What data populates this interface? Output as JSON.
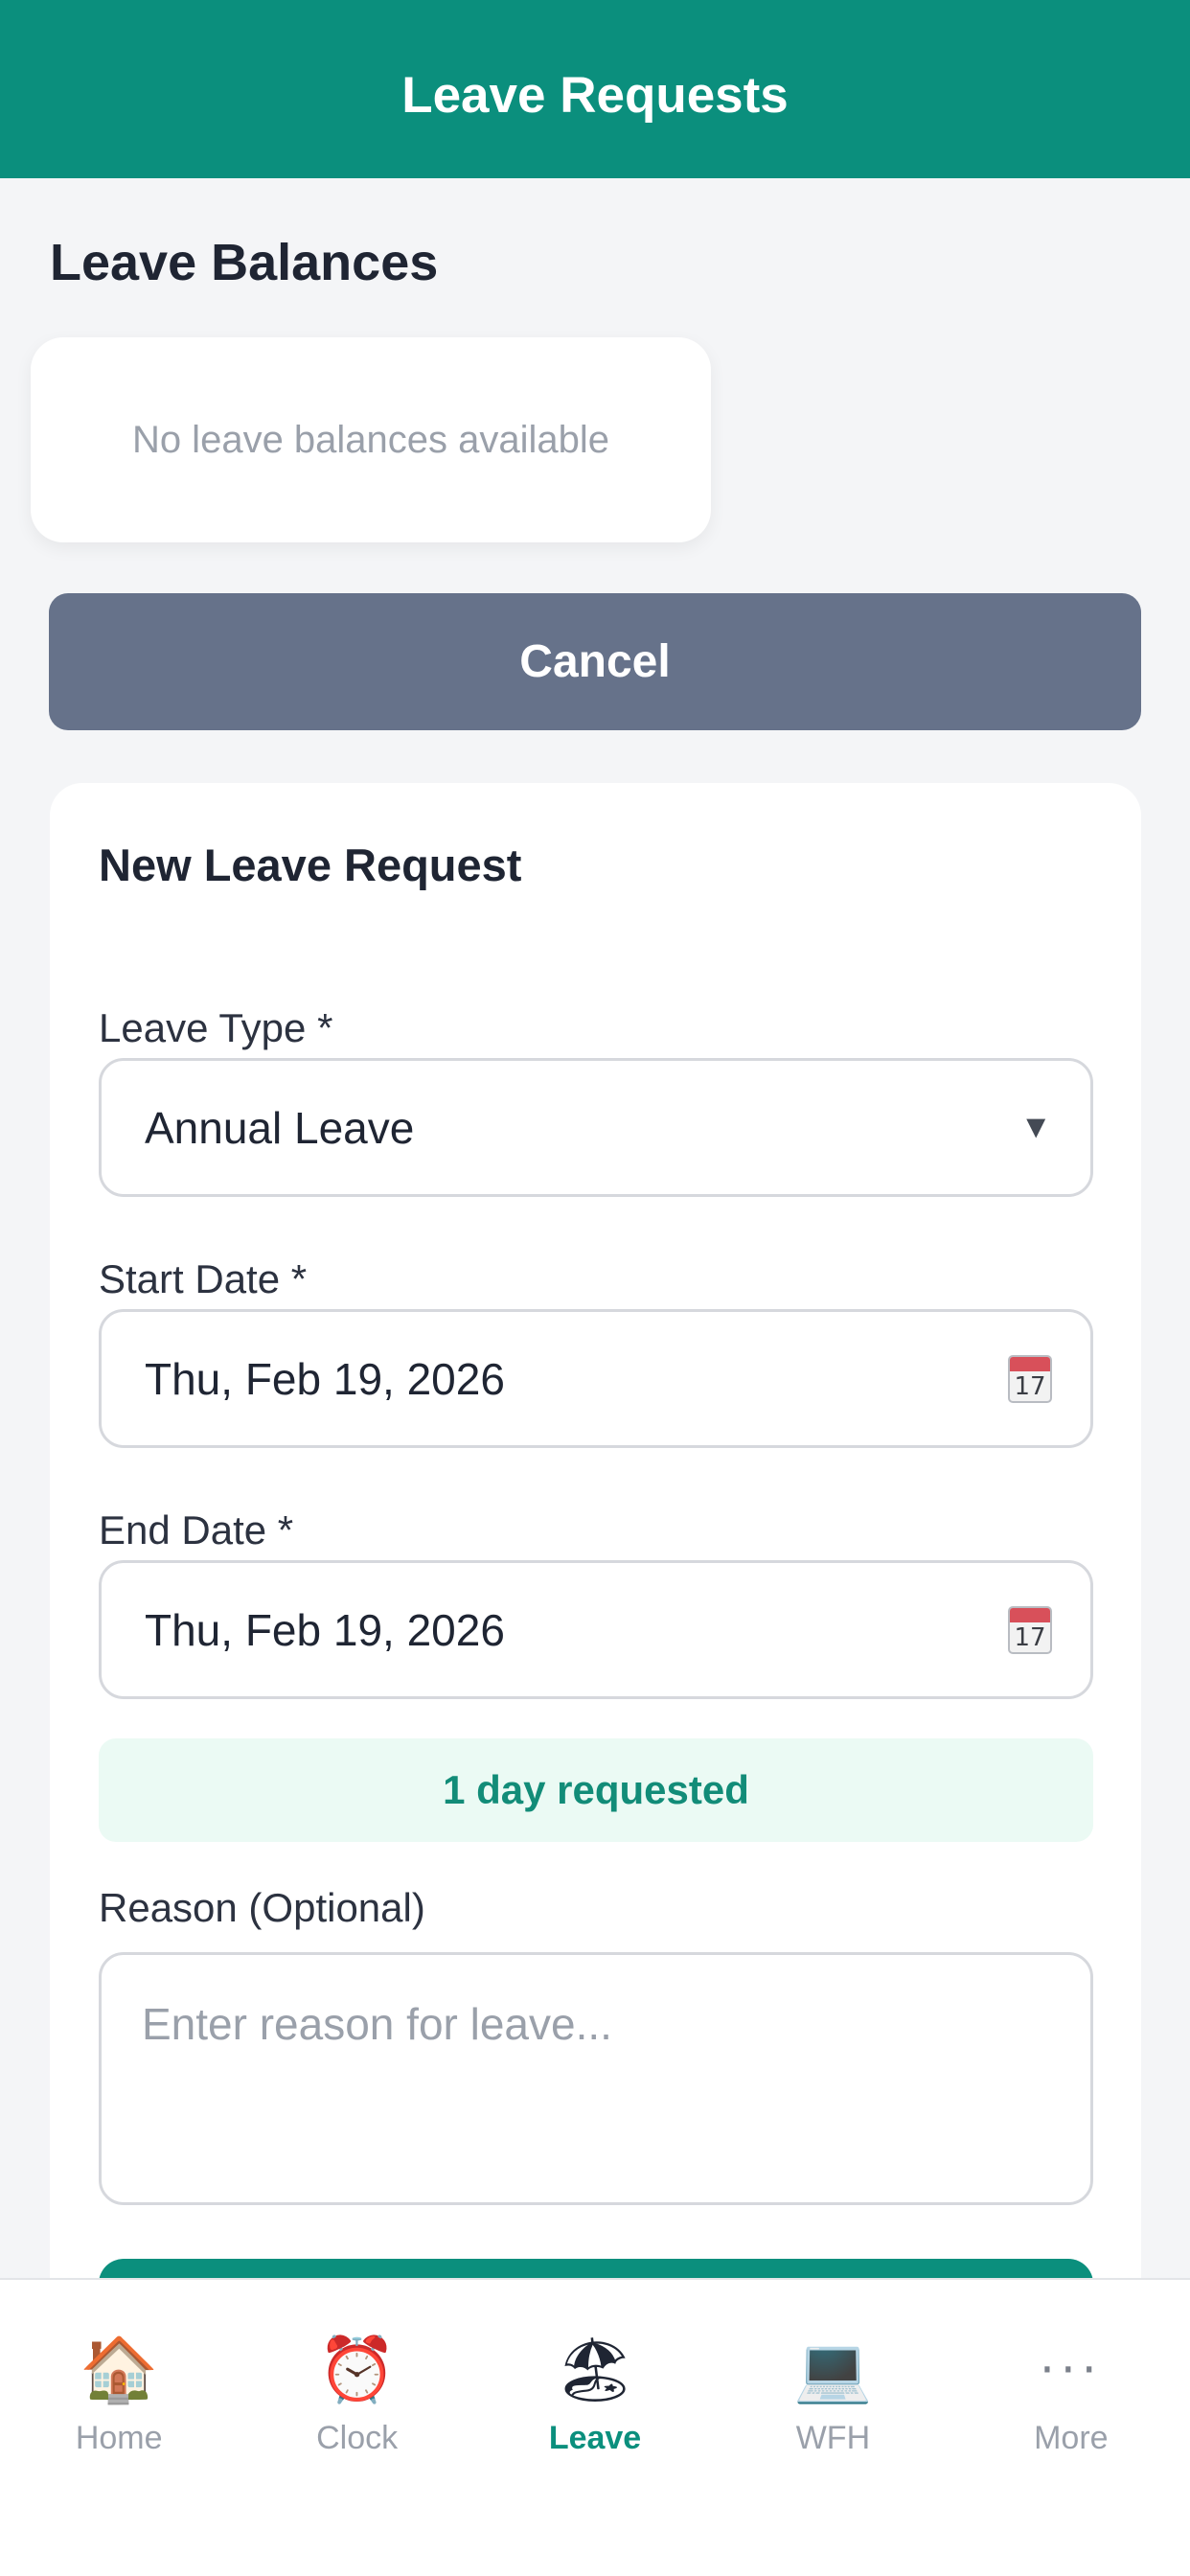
{
  "header": {
    "title": "Leave Requests"
  },
  "balances": {
    "title": "Leave Balances",
    "empty_text": "No leave balances available"
  },
  "cancel_button": {
    "label": "Cancel"
  },
  "form": {
    "title": "New Leave Request",
    "leave_type": {
      "label": "Leave Type *",
      "value": "Annual Leave"
    },
    "start_date": {
      "label": "Start Date *",
      "value": "Thu, Feb 19, 2026",
      "calendar_day": "17"
    },
    "end_date": {
      "label": "End Date *",
      "value": "Thu, Feb 19, 2026",
      "calendar_day": "17"
    },
    "days_requested": "1 day requested",
    "reason": {
      "label": "Reason (Optional)",
      "placeholder": "Enter reason for leave..."
    }
  },
  "tabbar": {
    "tabs": [
      {
        "label": "Home",
        "icon": "house-icon",
        "glyph": "🏠"
      },
      {
        "label": "Clock",
        "icon": "alarm-clock-icon",
        "glyph": "⏰"
      },
      {
        "label": "Leave",
        "icon": "beach-umbrella-icon",
        "glyph": "🏖"
      },
      {
        "label": "WFH",
        "icon": "laptop-icon",
        "glyph": "💻"
      },
      {
        "label": "More",
        "icon": "more-dots-icon",
        "glyph": "···"
      }
    ],
    "active": "Leave"
  },
  "colors": {
    "primary": "#0b8f7d",
    "cancel": "#66728a",
    "banner_bg": "#ebfaf4"
  }
}
